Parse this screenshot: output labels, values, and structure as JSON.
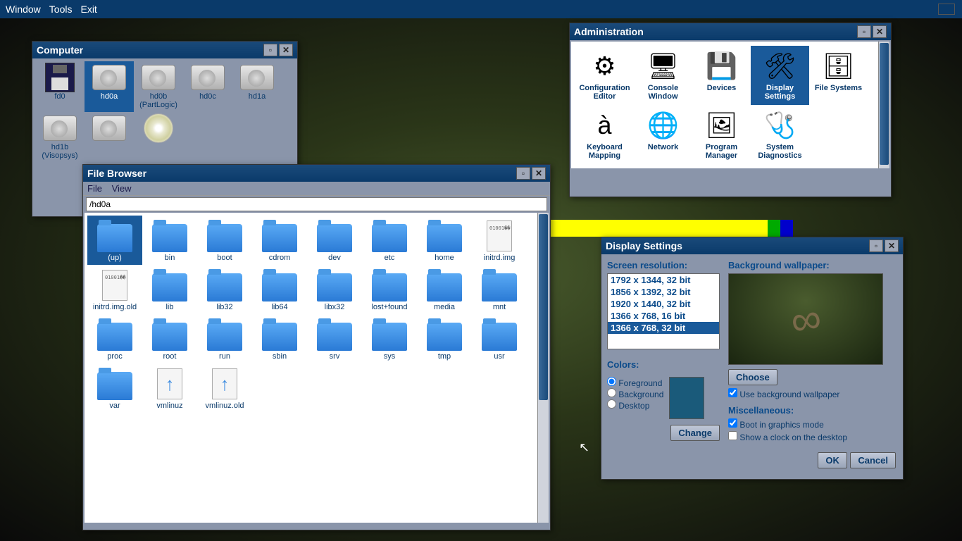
{
  "menubar": {
    "window": "Window",
    "tools": "Tools",
    "exit": "Exit"
  },
  "computer": {
    "title": "Computer",
    "drives": [
      {
        "name": "fd0",
        "type": "floppy"
      },
      {
        "name": "hd0a",
        "type": "hdd",
        "selected": true
      },
      {
        "name": "hd0b (PartLogic)",
        "type": "hdd"
      },
      {
        "name": "hd0c",
        "type": "hdd"
      },
      {
        "name": "hd1a",
        "type": "hdd"
      },
      {
        "name": "hd1b (Visopsys)",
        "type": "hdd"
      },
      {
        "name": "",
        "type": "hdd"
      },
      {
        "name": "",
        "type": "cd"
      }
    ]
  },
  "filebrowser": {
    "title": "File Browser",
    "menu_file": "File",
    "menu_view": "View",
    "path": "/hd0a",
    "items": [
      {
        "name": "(up)",
        "type": "folder",
        "selected": true
      },
      {
        "name": "bin",
        "type": "folder"
      },
      {
        "name": "boot",
        "type": "folder"
      },
      {
        "name": "cdrom",
        "type": "folder"
      },
      {
        "name": "dev",
        "type": "folder"
      },
      {
        "name": "etc",
        "type": "folder"
      },
      {
        "name": "home",
        "type": "folder"
      },
      {
        "name": "initrd.img",
        "type": "file"
      },
      {
        "name": "initrd.img.old",
        "type": "file"
      },
      {
        "name": "lib",
        "type": "folder"
      },
      {
        "name": "lib32",
        "type": "folder"
      },
      {
        "name": "lib64",
        "type": "folder"
      },
      {
        "name": "libx32",
        "type": "folder"
      },
      {
        "name": "lost+found",
        "type": "folder"
      },
      {
        "name": "media",
        "type": "folder"
      },
      {
        "name": "mnt",
        "type": "folder"
      },
      {
        "name": "proc",
        "type": "folder"
      },
      {
        "name": "root",
        "type": "folder"
      },
      {
        "name": "run",
        "type": "folder"
      },
      {
        "name": "sbin",
        "type": "folder"
      },
      {
        "name": "srv",
        "type": "folder"
      },
      {
        "name": "sys",
        "type": "folder"
      },
      {
        "name": "tmp",
        "type": "folder"
      },
      {
        "name": "usr",
        "type": "folder"
      },
      {
        "name": "var",
        "type": "folder"
      },
      {
        "name": "vmlinuz",
        "type": "arrow"
      },
      {
        "name": "vmlinuz.old",
        "type": "arrow"
      }
    ]
  },
  "admin": {
    "title": "Administration",
    "items": [
      {
        "name": "Configuration Editor",
        "icon": "⚙"
      },
      {
        "name": "Console Window",
        "icon": "🖥"
      },
      {
        "name": "Devices",
        "icon": "💾"
      },
      {
        "name": "Display Settings",
        "icon": "🛠",
        "selected": true
      },
      {
        "name": "File Systems",
        "icon": "🗄"
      },
      {
        "name": "Keyboard Mapping",
        "icon": "à"
      },
      {
        "name": "Network",
        "icon": "🌐"
      },
      {
        "name": "Program Manager",
        "icon": "🖼"
      },
      {
        "name": "System Diagnostics",
        "icon": "🩺"
      }
    ]
  },
  "display": {
    "title": "Display Settings",
    "resolution_label": "Screen resolution:",
    "resolutions": [
      "1792 x 1344, 32 bit",
      "1856 x 1392, 32 bit",
      "1920 x 1440, 32 bit",
      "1366 x 768, 16 bit",
      "1366 x 768, 32 bit"
    ],
    "resolution_selected": 4,
    "colors_label": "Colors:",
    "color_foreground": "Foreground",
    "color_background": "Background",
    "color_desktop": "Desktop",
    "change_btn": "Change",
    "wallpaper_label": "Background wallpaper:",
    "choose_btn": "Choose",
    "use_wallpaper": "Use background wallpaper",
    "misc_label": "Miscellaneous:",
    "boot_graphics": "Boot in graphics mode",
    "show_clock": "Show a clock on the desktop",
    "ok_btn": "OK",
    "cancel_btn": "Cancel"
  }
}
